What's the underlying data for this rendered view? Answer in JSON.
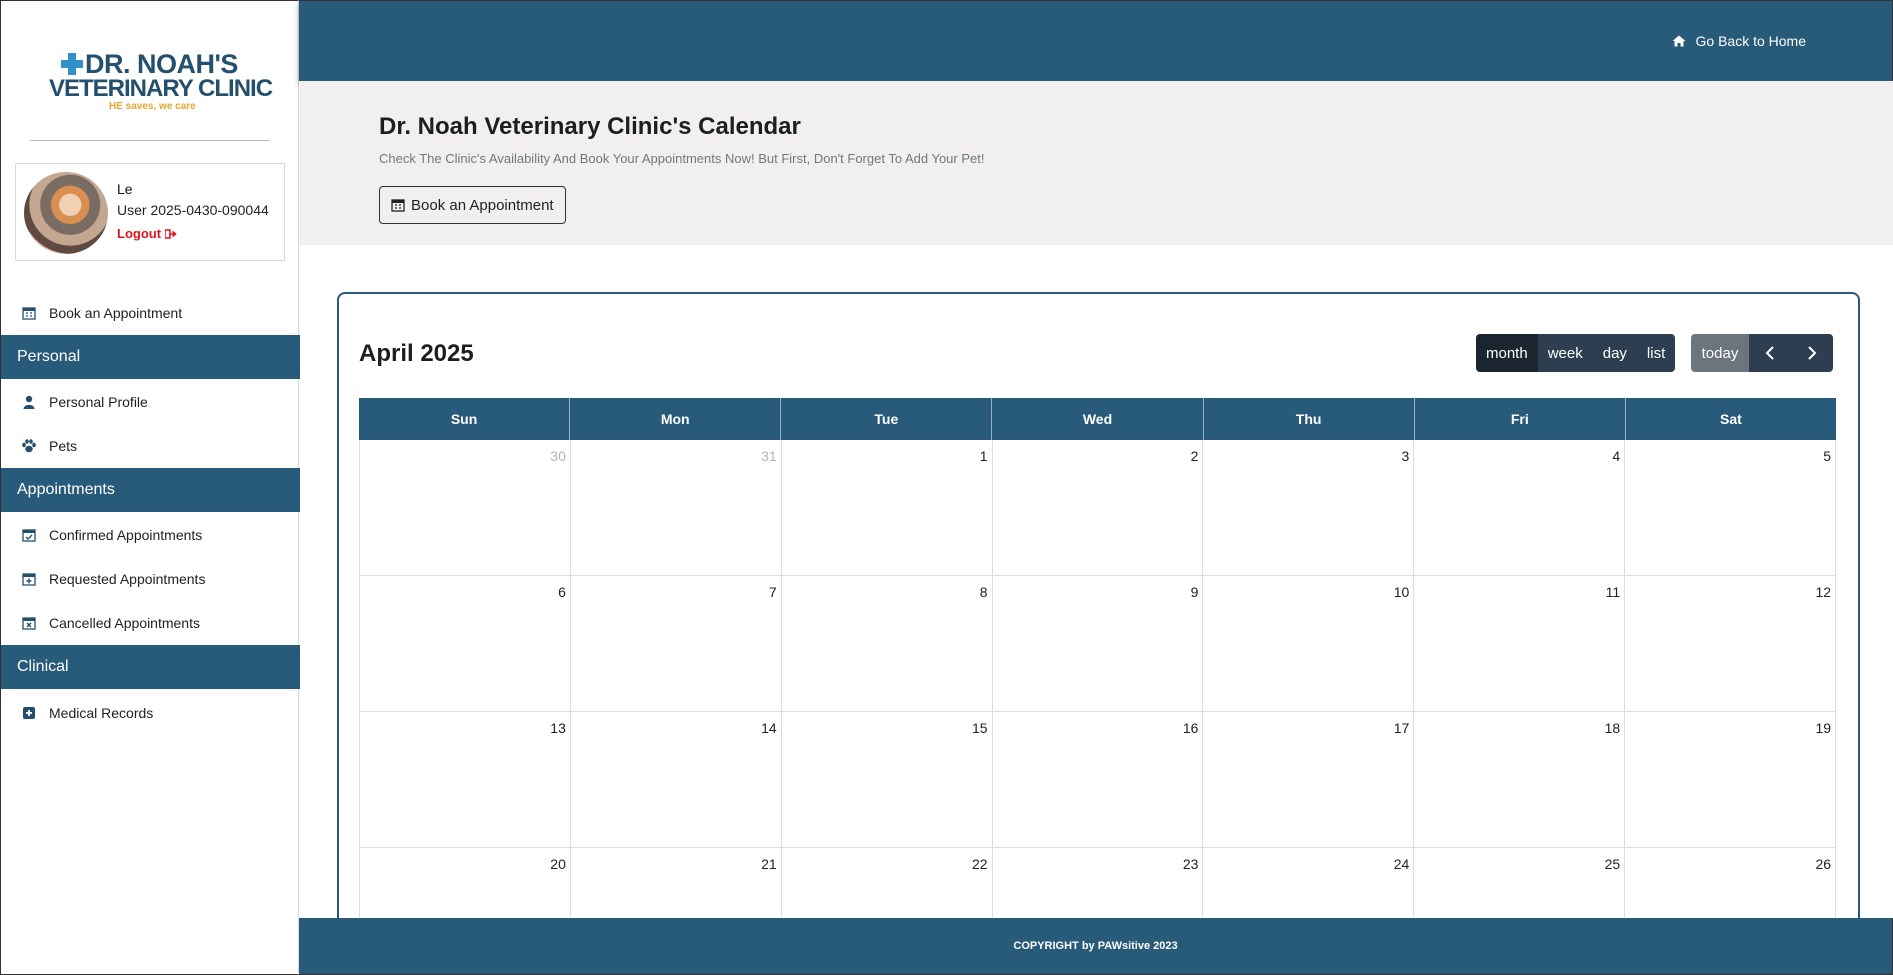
{
  "sidebar": {
    "logo": {
      "line1": "DR. NOAH'S",
      "line2": "VETERINARY CLINIC",
      "tagline": "HE saves, we care"
    },
    "profile": {
      "name": "Le",
      "user_id": "User 2025-0430-090044",
      "logout_label": "Logout"
    },
    "book_label": "Book an Appointment",
    "sections": [
      {
        "title": "Personal",
        "items": [
          {
            "label": "Personal Profile",
            "icon": "user-icon"
          },
          {
            "label": "Pets",
            "icon": "paw-icon"
          }
        ]
      },
      {
        "title": "Appointments",
        "items": [
          {
            "label": "Confirmed Appointments",
            "icon": "calendar-check-icon"
          },
          {
            "label": "Requested Appointments",
            "icon": "calendar-plus-icon"
          },
          {
            "label": "Cancelled Appointments",
            "icon": "calendar-x-icon"
          }
        ]
      },
      {
        "title": "Clinical",
        "items": [
          {
            "label": "Medical Records",
            "icon": "plus-square-icon"
          }
        ]
      }
    ]
  },
  "topbar": {
    "home_label": "Go Back to Home"
  },
  "header": {
    "title": "Dr. Noah Veterinary Clinic's Calendar",
    "subtitle": "Check The Clinic's Availability And Book Your Appointments Now! But First, Don't Forget To Add Your Pet!",
    "book_button": "Book an Appointment"
  },
  "calendar": {
    "title": "April 2025",
    "views": [
      "month",
      "week",
      "day",
      "list"
    ],
    "active_view": "month",
    "today_label": "today",
    "weekdays": [
      "Sun",
      "Mon",
      "Tue",
      "Wed",
      "Thu",
      "Fri",
      "Sat"
    ],
    "weeks": [
      [
        {
          "d": "30",
          "other": true
        },
        {
          "d": "31",
          "other": true
        },
        {
          "d": "1"
        },
        {
          "d": "2"
        },
        {
          "d": "3"
        },
        {
          "d": "4"
        },
        {
          "d": "5"
        }
      ],
      [
        {
          "d": "6"
        },
        {
          "d": "7"
        },
        {
          "d": "8"
        },
        {
          "d": "9"
        },
        {
          "d": "10"
        },
        {
          "d": "11"
        },
        {
          "d": "12"
        }
      ],
      [
        {
          "d": "13"
        },
        {
          "d": "14"
        },
        {
          "d": "15"
        },
        {
          "d": "16"
        },
        {
          "d": "17"
        },
        {
          "d": "18"
        },
        {
          "d": "19"
        }
      ],
      [
        {
          "d": "20"
        },
        {
          "d": "21"
        },
        {
          "d": "22"
        },
        {
          "d": "23"
        },
        {
          "d": "24"
        },
        {
          "d": "25"
        },
        {
          "d": "26"
        }
      ]
    ]
  },
  "footer": {
    "text": "COPYRIGHT by PAWsitive 2023"
  },
  "colors": {
    "primary": "#285a7a",
    "dark_button": "#2c3e50",
    "today_button": "#6c757d",
    "logout": "#e0141e",
    "logo_accent": "#e6a531"
  }
}
